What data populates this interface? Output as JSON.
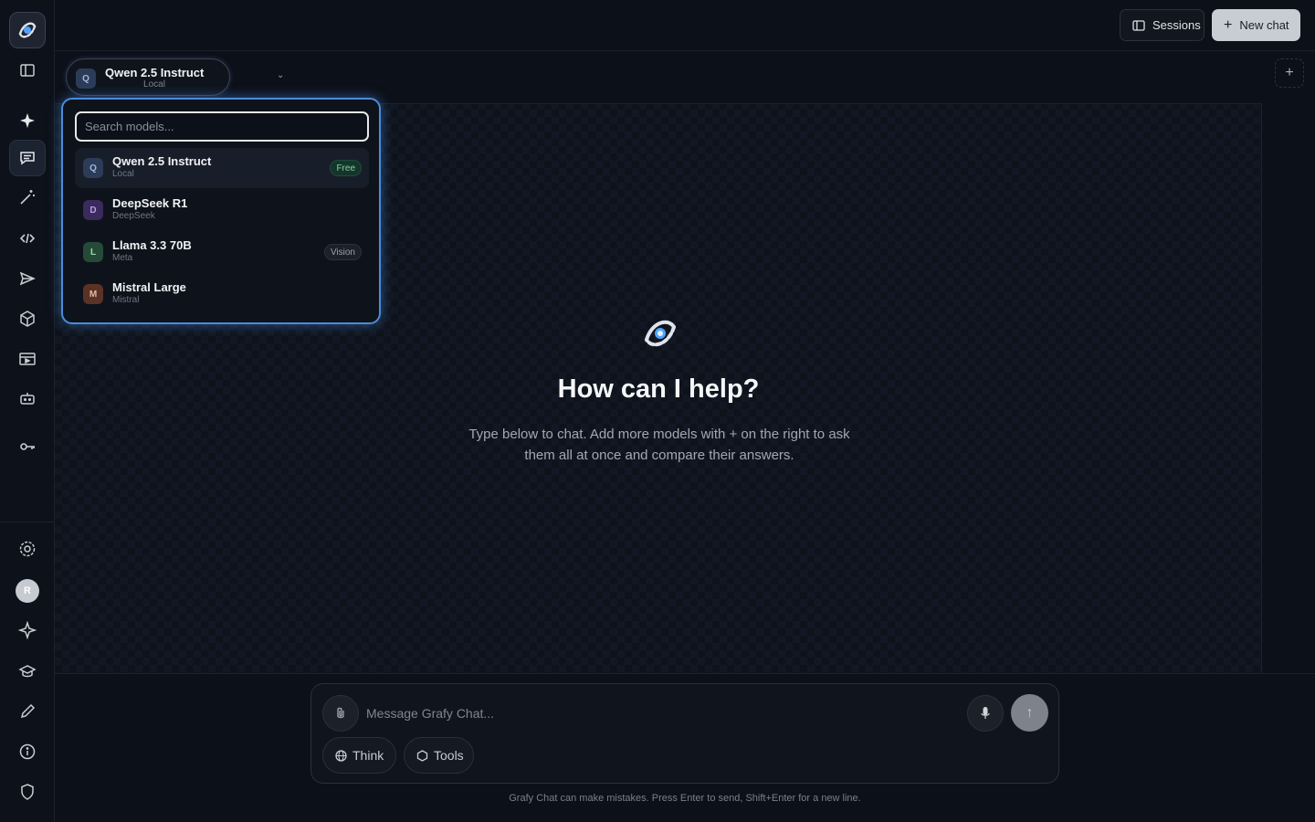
{
  "rail": {
    "items": [
      {
        "name": "sparkle-icon"
      },
      {
        "name": "chat-icon"
      },
      {
        "name": "magic-wand-icon"
      },
      {
        "name": "code-icon"
      },
      {
        "name": "send-icon"
      },
      {
        "name": "cube-icon"
      },
      {
        "name": "film-icon"
      },
      {
        "name": "robot-icon"
      },
      {
        "name": "key-icon"
      }
    ],
    "avatar_initial": "R"
  },
  "topbar": {
    "sessions_label": "Sessions",
    "new_chat_label": "New chat"
  },
  "model_selector": {
    "chip": "Q",
    "name": "Qwen 2.5 Instruct",
    "provider": "Local"
  },
  "dropdown": {
    "search_placeholder": "Search models...",
    "models": [
      {
        "chip": "Q",
        "name": "Qwen 2.5 Instruct",
        "provider": "Local",
        "badge": "Free",
        "chip_bg": "#2c3c58",
        "chip_fg": "#9fb7e0"
      },
      {
        "chip": "D",
        "name": "DeepSeek R1",
        "provider": "DeepSeek",
        "badge": "",
        "chip_bg": "#3b2a5c",
        "chip_fg": "#b8a1e6"
      },
      {
        "chip": "L",
        "name": "Llama 3.3 70B",
        "provider": "Meta",
        "badge": "Vision",
        "chip_bg": "#254a37",
        "chip_fg": "#9bd6b2"
      },
      {
        "chip": "M",
        "name": "Mistral Large",
        "provider": "Mistral",
        "badge": "",
        "chip_bg": "#5a3326",
        "chip_fg": "#e8b8a2"
      }
    ]
  },
  "hero": {
    "title": "How can I help?",
    "text": "Type below to chat. Add more models with + on the right to ask them all at once and compare their answers."
  },
  "composer": {
    "placeholder": "Message Grafy Chat...",
    "think_label": "Think",
    "tools_label": "Tools"
  },
  "footnote": "Grafy Chat can make mistakes. Press Enter to send, Shift+Enter for a new line.",
  "colors": {
    "accent": "#4a8cd8",
    "background": "#0c1018"
  }
}
